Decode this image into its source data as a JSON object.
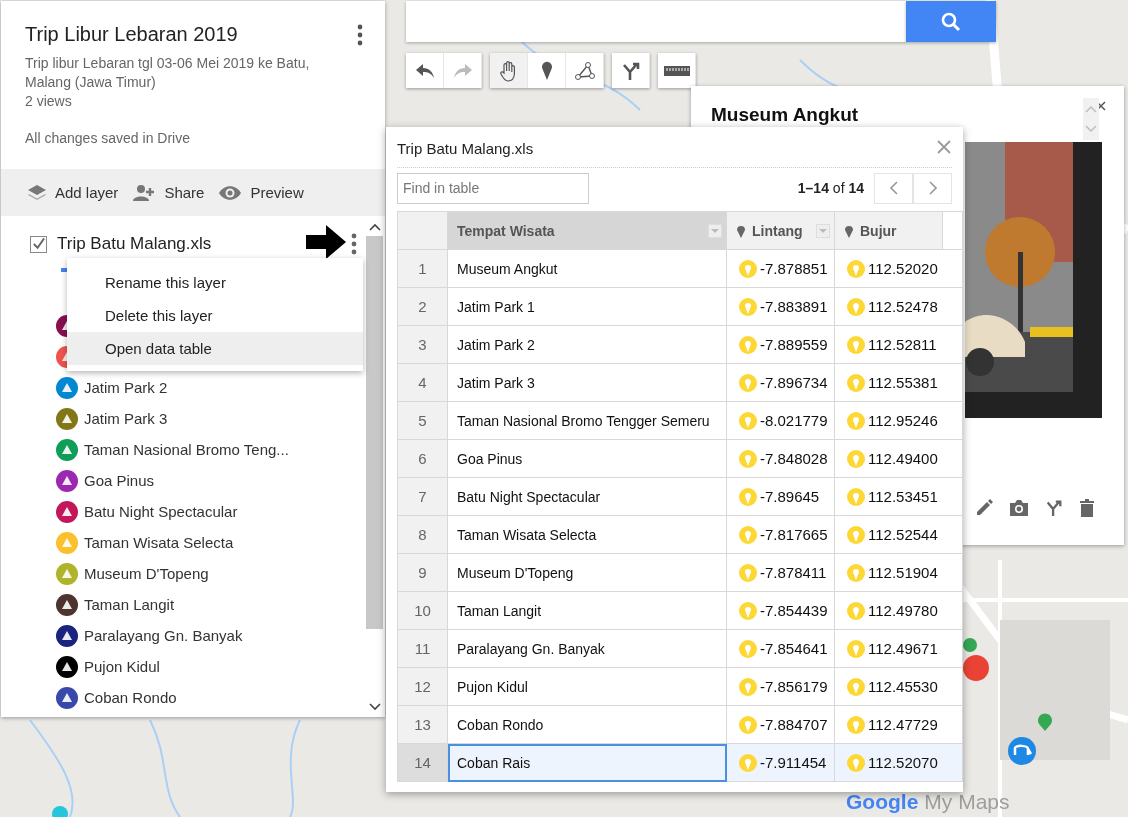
{
  "map_title": "Trip Libur Lebaran 2019",
  "description": "Trip libur Lebaran tgl 03-06 Mei 2019 ke Batu, Malang (Jawa Timur)",
  "views": "2 views",
  "save_status": "All changes saved in Drive",
  "actions": [
    {
      "label": "Add layer",
      "kind": "layers"
    },
    {
      "label": "Share",
      "kind": "share"
    },
    {
      "label": "Preview",
      "kind": "preview"
    }
  ],
  "layer": {
    "name": "Trip Batu Malang.xls",
    "checked": true,
    "items": [
      {
        "color": "#880e4f"
      },
      {
        "color": "#ef5350"
      },
      {
        "label": "Jatim Park 2",
        "color": "#0288d1"
      },
      {
        "label": "Jatim Park 3",
        "color": "#827717"
      },
      {
        "label": "Taman Nasional Bromo Teng...",
        "color": "#0f9d58"
      },
      {
        "label": "Goa Pinus",
        "color": "#9c27b0"
      },
      {
        "label": "Batu Night Spectacular",
        "color": "#c2185b"
      },
      {
        "label": "Taman Wisata Selecta",
        "color": "#fbc02d"
      },
      {
        "label": "Museum D'Topeng",
        "color": "#afb42b"
      },
      {
        "label": "Taman Langit",
        "color": "#4e342e"
      },
      {
        "label": "Paralayang Gn. Banyak",
        "color": "#1a237e"
      },
      {
        "label": "Pujon Kidul",
        "color": "#000000"
      },
      {
        "label": "Coban Rondo",
        "color": "#3949ab"
      }
    ]
  },
  "layer_menu": [
    {
      "label": "Rename this layer",
      "selected": false
    },
    {
      "label": "Delete this layer",
      "selected": false
    },
    {
      "label": "Open data table",
      "selected": true
    }
  ],
  "info_card": {
    "title": "Museum Angkut"
  },
  "table": {
    "title": "Trip Batu Malang.xls",
    "find_placeholder": "Find in table",
    "pagination": "**1–14** of **14**",
    "columns": [
      {
        "label": "Tempat Wisata",
        "kind": "text",
        "selected": true,
        "dropdown": true
      },
      {
        "label": "Lintang",
        "kind": "location",
        "selected": false,
        "dropdown": true
      },
      {
        "label": "Bujur",
        "kind": "location",
        "selected": false,
        "dropdown": false
      }
    ],
    "rows": [
      {
        "num": "1",
        "name": "Museum Angkut",
        "lat": "-7.878851",
        "lng": "112.52020",
        "selected": false
      },
      {
        "num": "2",
        "name": "Jatim Park 1",
        "lat": "-7.883891",
        "lng": "112.52478",
        "selected": false
      },
      {
        "num": "3",
        "name": "Jatim Park 2",
        "lat": "-7.889559",
        "lng": "112.52811",
        "selected": false
      },
      {
        "num": "4",
        "name": "Jatim Park 3",
        "lat": "-7.896734",
        "lng": "112.55381",
        "selected": false
      },
      {
        "num": "5",
        "name": "Taman Nasional Bromo Tengger Semeru",
        "lat": "-8.021779",
        "lng": "112.95246",
        "selected": false
      },
      {
        "num": "6",
        "name": "Goa Pinus",
        "lat": "-7.848028",
        "lng": "112.49400",
        "selected": false
      },
      {
        "num": "7",
        "name": "Batu Night Spectacular",
        "lat": "-7.89645",
        "lng": "112.53451",
        "selected": false
      },
      {
        "num": "8",
        "name": "Taman Wisata Selecta",
        "lat": "-7.817665",
        "lng": "112.52544",
        "selected": false
      },
      {
        "num": "9",
        "name": "Museum D'Topeng",
        "lat": "-7.878411",
        "lng": "112.51904",
        "selected": false
      },
      {
        "num": "10",
        "name": "Taman Langit",
        "lat": "-7.854439",
        "lng": "112.49780",
        "selected": false
      },
      {
        "num": "11",
        "name": "Paralayang Gn. Banyak",
        "lat": "-7.854641",
        "lng": "112.49671",
        "selected": false
      },
      {
        "num": "12",
        "name": "Pujon Kidul",
        "lat": "-7.856179",
        "lng": "112.45530",
        "selected": false
      },
      {
        "num": "13",
        "name": "Coban Rondo",
        "lat": "-7.884707",
        "lng": "112.47729",
        "selected": false
      },
      {
        "num": "14",
        "name": "Coban Rais",
        "lat": "-7.911454",
        "lng": "112.52070",
        "selected": true
      }
    ]
  },
  "map_footer": {
    "brand": "Google",
    "product": "My Maps"
  }
}
